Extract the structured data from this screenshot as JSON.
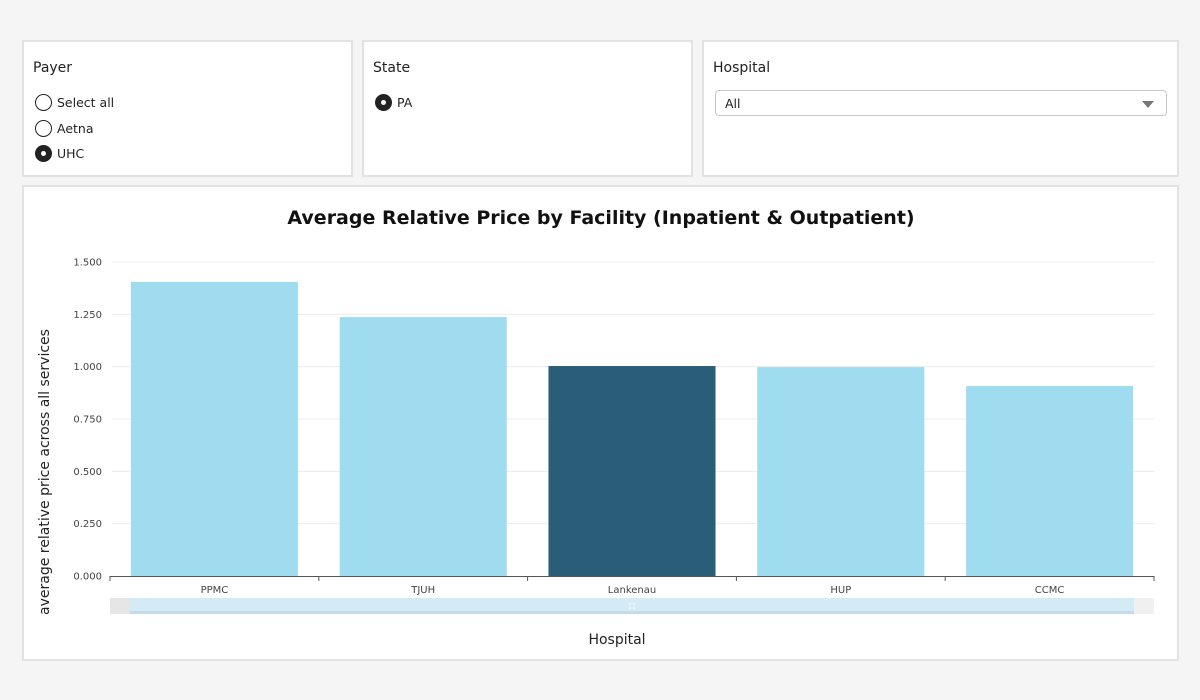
{
  "filters": {
    "payer": {
      "label": "Payer",
      "options": [
        {
          "label": "Select all",
          "selected": false
        },
        {
          "label": "Aetna",
          "selected": false
        },
        {
          "label": "UHC",
          "selected": true
        }
      ]
    },
    "state": {
      "label": "State",
      "options": [
        {
          "label": "PA",
          "selected": true
        }
      ]
    },
    "hospital": {
      "label": "Hospital",
      "selected_value": "All",
      "caret_icon": "chevron-down-icon"
    }
  },
  "colors": {
    "bar_default": "#a0dcef",
    "bar_highlight": "#2a5d78",
    "grid": "#ececec",
    "axis": "#555555",
    "scrollbar_track": "#d4ebf6"
  },
  "chart_data": {
    "type": "bar",
    "title": "Average Relative Price by Facility (Inpatient & Outpatient)",
    "xlabel": "Hospital",
    "ylabel": "average relative price across all services",
    "categories": [
      "PPMC",
      "TJUH",
      "Lankenau",
      "HUP",
      "CCMC"
    ],
    "values": [
      1.405,
      1.237,
      1.003,
      0.998,
      0.908
    ],
    "highlighted": [
      "Lankenau"
    ],
    "ylim": [
      0,
      1.5
    ],
    "yticks": [
      0,
      0.25,
      0.5,
      0.75,
      1.0,
      1.25,
      1.5
    ],
    "ytick_labels": [
      "0.000",
      "0.250",
      "0.500",
      "0.750",
      "1.000",
      "1.250",
      "1.500"
    ],
    "grid": true,
    "legend": "none",
    "scrollbar": true
  }
}
